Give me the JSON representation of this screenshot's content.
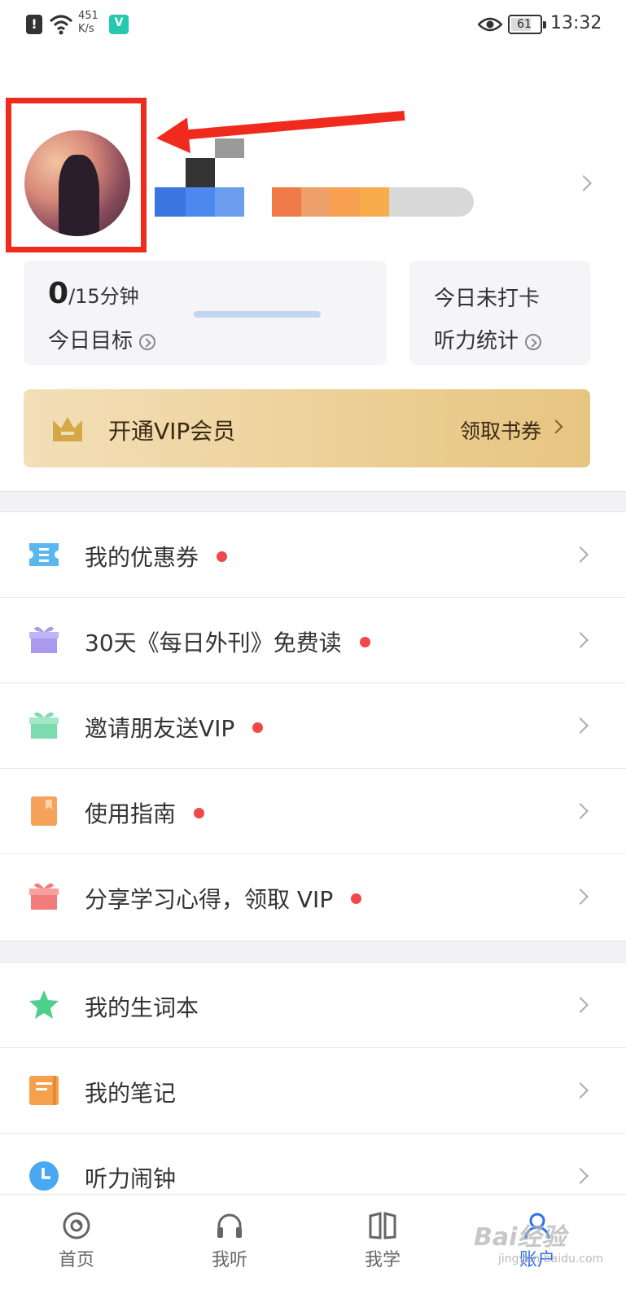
{
  "status_bar": {
    "alert_glyph": "!",
    "net_speed_value": "451",
    "net_speed_unit": "K/s",
    "app_glyph": "V",
    "battery": "61",
    "time": "13:32"
  },
  "goal_card": {
    "current": "0",
    "target": "/15分钟",
    "label": "今日目标",
    "progress_fraction": 0
  },
  "stats_card": {
    "checkin_status": "今日未打卡",
    "label": "听力统计"
  },
  "vip_banner": {
    "title": "开通VIP会员",
    "coupon_label": "领取书券"
  },
  "menu_group_1": [
    {
      "label": "我的优惠券",
      "icon": "ticket-icon",
      "icon_color": "#5ab7f0"
    },
    {
      "label": "30天《每日外刊》免费读",
      "icon": "gift-icon",
      "icon_color": "#a99af0"
    },
    {
      "label": "邀请朋友送VIP",
      "icon": "gift-icon",
      "icon_color": "#7ddbb0"
    },
    {
      "label": "使用指南",
      "icon": "book-icon",
      "icon_color": "#f5a25a"
    },
    {
      "label": "分享学习心得，领取 VIP",
      "icon": "gift-icon",
      "icon_color": "#f27b7b"
    }
  ],
  "menu_group_2": [
    {
      "label": "我的生词本",
      "icon": "star-icon",
      "icon_color": "#4cd08a"
    },
    {
      "label": "我的笔记",
      "icon": "notebook-icon",
      "icon_color": "#f5a04c"
    },
    {
      "label": "听力闹钟",
      "icon": "clock-icon",
      "icon_color": "#4aa8f0"
    }
  ],
  "bottom_nav": [
    {
      "label": "首页",
      "icon": "home-icon"
    },
    {
      "label": "我听",
      "icon": "headphones-icon"
    },
    {
      "label": "我学",
      "icon": "book-open-icon"
    },
    {
      "label": "账户",
      "icon": "user-icon",
      "active": true
    }
  ],
  "watermark": {
    "text": "Bai经验",
    "url_text": "jingyan.baidu.com"
  },
  "colors": {
    "highlight": "#f02a1c",
    "red_dot": "#f04848",
    "accent_blue": "#2f6fe8",
    "vip_gold": "#eccf95"
  }
}
